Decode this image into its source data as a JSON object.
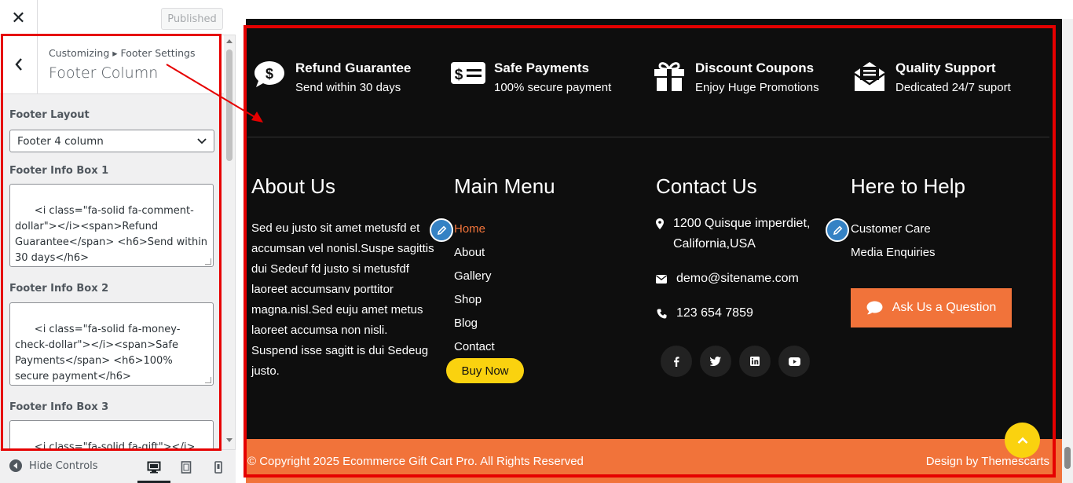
{
  "topbar": {
    "close_label": "✕",
    "publish_label": "Published"
  },
  "section": {
    "breadcrumb": "Customizing ▸ Footer Settings",
    "title": "Footer Column"
  },
  "controls": {
    "layout_label": "Footer Layout",
    "layout_value": "Footer 4 column",
    "box1_label": "Footer Info Box 1",
    "box1_value": "<i class=\"fa-solid fa-comment-dollar\"></i><span>Refund Guarantee</span> <h6>Send within 30 days</h6>",
    "box2_label": "Footer Info Box 2",
    "box2_value": "<i class=\"fa-solid fa-money-check-dollar\"></i><span>Safe Payments</span> <h6>100% secure payment</h6>",
    "box3_label": "Footer Info Box 3",
    "box3_value": "<i class=\"fa-solid fa-gift\"></i><span>Discount Coupons</span>"
  },
  "sidebar_footer": {
    "hide_label": "Hide Controls"
  },
  "info_boxes": [
    {
      "icon": "comment-dollar-icon",
      "title": "Refund Guarantee",
      "subtitle": "Send within 30 days"
    },
    {
      "icon": "money-check-dollar-icon",
      "title": "Safe Payments",
      "subtitle": "100% secure payment"
    },
    {
      "icon": "gift-icon",
      "title": "Discount Coupons",
      "subtitle": "Enjoy Huge Promotions"
    },
    {
      "icon": "envelope-open-text-icon",
      "title": "Quality Support",
      "subtitle": "Dedicated 24/7 suport"
    }
  ],
  "about": {
    "heading": "About Us",
    "text": "Sed eu justo sit amet metusfd et accumsan vel nonisl.Suspe sagittis dui Sedeuf fd justo si metusfdf laoreet accumsanv porttitor magna.nisl.Sed euju amet metus laoreet accumsa non nisli. Suspend isse sagitt is dui Sedeug justo."
  },
  "main_menu": {
    "heading": "Main Menu",
    "items": [
      "Home",
      "About",
      "Gallery",
      "Shop",
      "Blog",
      "Contact"
    ],
    "button": "Buy Now"
  },
  "contact": {
    "heading": "Contact Us",
    "address": "1200 Quisque imperdiet, California,USA",
    "email": "demo@sitename.com",
    "phone": "123 654 7859",
    "social": [
      "facebook-icon",
      "twitter-icon",
      "linkedin-icon",
      "youtube-icon"
    ]
  },
  "help": {
    "heading": "Here to Help",
    "items": [
      "Customer Care",
      "Media Enquiries"
    ],
    "button": "Ask Us a Question"
  },
  "copyright": {
    "text": "© Copyright 2025 Ecommerce Gift Cart Pro. All Rights Reserved",
    "design_by": "Design by Themescarts"
  },
  "colors": {
    "accent_orange": "#f1733a",
    "accent_yellow": "#fad20f",
    "footer_bg": "#0e0e0e",
    "highlight_red": "#e60000",
    "edit_blue": "#3582c4"
  }
}
